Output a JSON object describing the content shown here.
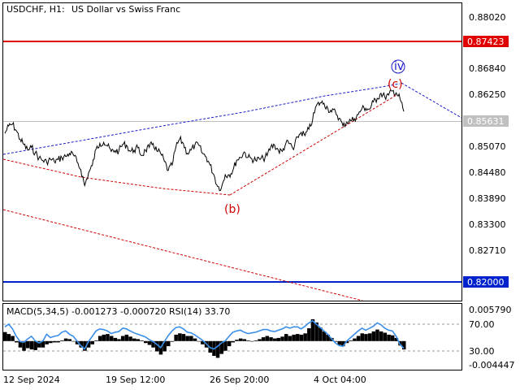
{
  "header": {
    "symbol_label": "USDCHF, H1:",
    "description": "US Dollar vs Swiss Franc"
  },
  "colors": {
    "resistance": "#e00000",
    "support": "#0022cc",
    "current_bg": "#c0c0c0",
    "wave_red": "#d00000",
    "wave_blue": "#1a1acc",
    "macd_hist": "#000000",
    "rsi_line": "#3b8ee8"
  },
  "chart_data": [
    {
      "type": "line",
      "title": "USDCHF, H1:  US Dollar vs Swiss Franc",
      "ylim": [
        0.8164,
        0.8818
      ],
      "y_ticks": [
        "0.88020",
        "0.86840",
        "0.86250",
        "0.85070",
        "0.84480",
        "0.83890",
        "0.83300",
        "0.82710"
      ],
      "x_ticks": [
        "12 Sep 2024",
        "19 Sep 12:00",
        "26 Sep 20:00",
        "4 Oct 04:00"
      ],
      "price_levels": [
        {
          "name": "resistance",
          "value": "0.87423"
        },
        {
          "name": "current",
          "value": "0.85631"
        },
        {
          "name": "support",
          "value": "0.82000"
        }
      ],
      "series": [
        {
          "values": [
            0.8532,
            0.8548,
            0.8552,
            0.8538,
            0.8519,
            0.8507,
            0.8495,
            0.8501,
            0.8489,
            0.8478,
            0.8472,
            0.8469,
            0.8475,
            0.847,
            0.8474,
            0.8479,
            0.8481,
            0.8488,
            0.8485,
            0.8469,
            0.8452,
            0.8417,
            0.8444,
            0.8461,
            0.8497,
            0.851,
            0.8512,
            0.8504,
            0.8492,
            0.8494,
            0.8493,
            0.8508,
            0.8506,
            0.8492,
            0.8495,
            0.85,
            0.8483,
            0.8495,
            0.8501,
            0.851,
            0.8493,
            0.8488,
            0.847,
            0.845,
            0.8462,
            0.8501,
            0.8519,
            0.8509,
            0.8488,
            0.8495,
            0.8506,
            0.8506,
            0.8488,
            0.848,
            0.8462,
            0.8441,
            0.8415,
            0.8412,
            0.8441,
            0.8441,
            0.845,
            0.8473,
            0.8479,
            0.8491,
            0.8479,
            0.8476,
            0.8473,
            0.8475,
            0.8476,
            0.8483,
            0.8502,
            0.8506,
            0.8494,
            0.8492,
            0.8511,
            0.8509,
            0.8496,
            0.8524,
            0.8534,
            0.8527,
            0.8541,
            0.8562,
            0.8593,
            0.8599,
            0.8598,
            0.8587,
            0.8579,
            0.858,
            0.8565,
            0.8548,
            0.8557,
            0.856,
            0.8564,
            0.8573,
            0.8587,
            0.8587,
            0.8585,
            0.8601,
            0.8609,
            0.862,
            0.8612,
            0.8616,
            0.8625,
            0.8621,
            0.8608,
            0.858
          ],
          "low": 0.84054,
          "high": 0.86284
        },
        {
          "type": "line",
          "name": "wave-b-to-c-channel",
          "values": [
            0.8476,
            0.8421,
            0.841,
            0.8432,
            0.8468,
            0.8519,
            0.8562,
            0.8611,
            0.8623
          ],
          "x_index": [
            0,
            60,
            65,
            73,
            80,
            86,
            92,
            100,
            103
          ]
        }
      ],
      "annotations": [
        {
          "label": "(b)",
          "value": 0.8405
        },
        {
          "label": "(c)",
          "value": 0.8643
        },
        {
          "label": "iv",
          "value": 0.8655
        }
      ]
    },
    {
      "type": "area",
      "title": "MACD(5,34,5) -0.001273 -0.000720 RSI(14) 33.70",
      "ylim": [
        -0.004447,
        0.00579
      ],
      "y_ticks": [
        "0.005790",
        "70.00",
        "30.00",
        "-0.004447"
      ],
      "series": [
        {
          "name": "MACD",
          "values": [
            0.0014,
            0.0011,
            0.0008,
            -0.0002,
            -0.001,
            -0.0015,
            -0.0011,
            -0.0013,
            -0.0014,
            -0.001,
            -0.001,
            -0.0005,
            -0.0003,
            -0.0002,
            -0.0002,
            0.0001,
            0.0004,
            0.0003,
            0.0,
            -0.0005,
            -0.001,
            -0.0015,
            -0.001,
            -0.0005,
            0.0001,
            0.0008,
            0.001,
            0.0011,
            0.0008,
            0.0005,
            0.0003,
            0.0008,
            0.001,
            0.0007,
            0.0004,
            0.0003,
            0.0001,
            -0.0003,
            -0.0006,
            -0.001,
            -0.0016,
            -0.0021,
            -0.0016,
            -0.0008,
            -0.0001,
            0.001,
            0.0012,
            0.0011,
            0.0008,
            0.0008,
            0.0004,
            0.0,
            -0.0005,
            -0.001,
            -0.0018,
            -0.0023,
            -0.0026,
            -0.002,
            -0.0015,
            -0.0008,
            -0.0002,
            0.0002,
            0.0004,
            0.0003,
            0.0001,
            0.0,
            0.0001,
            0.0003,
            0.0006,
            0.0008,
            0.0006,
            0.0004,
            0.0005,
            0.0007,
            0.0011,
            0.0008,
            0.001,
            0.0011,
            0.001,
            0.0012,
            0.002,
            0.0034,
            0.0029,
            0.0021,
            0.0015,
            0.001,
            0.0005,
            -0.0001,
            -0.0006,
            -0.0008,
            -0.0003,
            0.0001,
            0.0004,
            0.0008,
            0.0012,
            0.0011,
            0.0012,
            0.0015,
            0.0018,
            0.0015,
            0.0013,
            0.001,
            0.0009,
            0.0005,
            -0.0007,
            -0.0013
          ]
        },
        {
          "name": "RSI(14)",
          "values": [
            66,
            70,
            63,
            52,
            44,
            43,
            48,
            52,
            45,
            42,
            45,
            55,
            50,
            52,
            53,
            58,
            60,
            55,
            52,
            45,
            38,
            33,
            44,
            52,
            60,
            63,
            62,
            60,
            56,
            58,
            59,
            64,
            63,
            60,
            57,
            55,
            53,
            51,
            47,
            44,
            40,
            35,
            44,
            53,
            60,
            65,
            66,
            63,
            58,
            57,
            54,
            50,
            46,
            41,
            35,
            33,
            37,
            42,
            45,
            52,
            58,
            60,
            61,
            58,
            56,
            57,
            58,
            60,
            62,
            62,
            60,
            59,
            61,
            63,
            66,
            64,
            66,
            66,
            63,
            67,
            72,
            75,
            70,
            65,
            60,
            55,
            48,
            42,
            38,
            37,
            45,
            50,
            55,
            60,
            64,
            61,
            64,
            67,
            72,
            69,
            64,
            61,
            60,
            52,
            40,
            34
          ]
        }
      ]
    }
  ]
}
